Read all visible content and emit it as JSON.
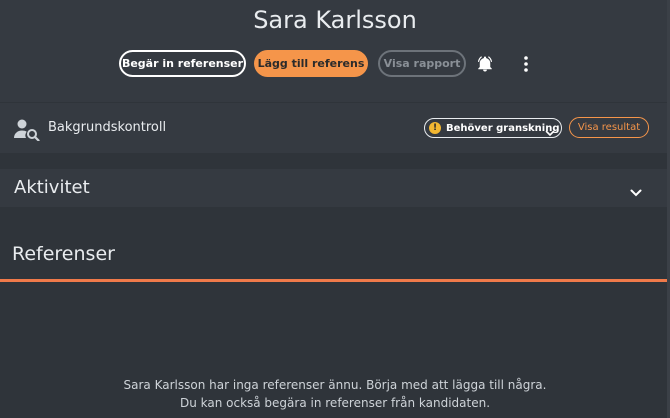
{
  "header": {
    "title": "Sara Karlsson",
    "buttons": {
      "request_references": "Begär in referenser",
      "add_reference": "Lägg till referens",
      "view_report": "Visa rapport"
    },
    "icons": [
      "bell-icon",
      "more-vert-icon"
    ]
  },
  "background_check": {
    "label": "Bakgrundskontroll",
    "status": "Behöver granskning",
    "status_color": "#f2b731",
    "view_results": "Visa resultat"
  },
  "activity": {
    "label": "Aktivitet"
  },
  "references": {
    "title": "Referenser",
    "empty_line1": "Sara Karlsson har inga referenser ännu. Börja med att lägga till några.",
    "empty_line2": "Du kan också begära in referenser från kandidaten."
  },
  "colors": {
    "accent": "#f5954a",
    "divider": "#f07a4a",
    "background": "#2f343a",
    "panel": "#353a41"
  }
}
